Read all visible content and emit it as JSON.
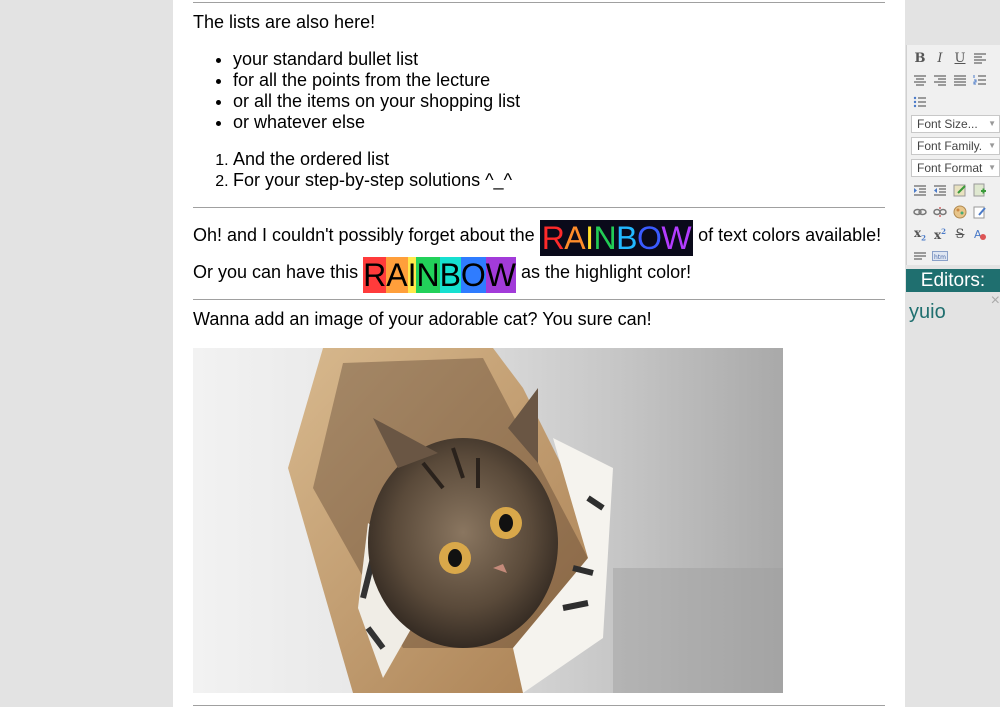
{
  "content": {
    "lists_intro": "The lists are also here!",
    "bullets": [
      "your standard bullet list",
      "for all the points from the lecture",
      "or all the items on your shopping list",
      "or whatever else"
    ],
    "ordered": [
      "And the ordered list",
      "For your step-by-step solutions ^_^"
    ],
    "colors_prefix": "Oh! and I couldn't possibly forget about the",
    "colors_suffix": "of text colors available!",
    "highlight_prefix": "Or you can have this",
    "highlight_suffix": "as the highlight color!",
    "rainbow_letters": [
      "R",
      "A",
      "I",
      "N",
      "B",
      "O",
      "W"
    ],
    "rainbow_text_colors": [
      "#ff2a2a",
      "#ff8c2a",
      "#ffe02a",
      "#22cc55",
      "#22b8ff",
      "#3a5bff",
      "#b33cff"
    ],
    "rainbow_bg_colors": [
      "#ff3b3b",
      "#ff9f3b",
      "#ffe84a",
      "#22d15a",
      "#16e0d0",
      "#2f7cff",
      "#a23bd9"
    ],
    "image_intro": "Wanna add an image of your adorable cat? You sure can!"
  },
  "toolbar": {
    "buttons": [
      "bold-icon",
      "italic-icon",
      "underline-icon",
      "align-left-icon",
      "align-center-icon",
      "align-right-icon",
      "align-justify-icon",
      "ordered-list-icon",
      "unordered-list-icon",
      "indent-icon",
      "outdent-icon",
      "insert-html-icon",
      "save-icon",
      "link-icon",
      "unlink-icon",
      "image-icon",
      "edit-icon",
      "subscript-icon",
      "superscript-icon",
      "strikethrough-icon",
      "text-color-icon",
      "horizontal-rule-icon",
      "code-icon"
    ],
    "font_size": "Font Size...",
    "font_family": "Font Family.",
    "font_format": "Font Format"
  },
  "editors": {
    "heading": "Editors:",
    "names": [
      "yuio"
    ],
    "close": "×"
  }
}
